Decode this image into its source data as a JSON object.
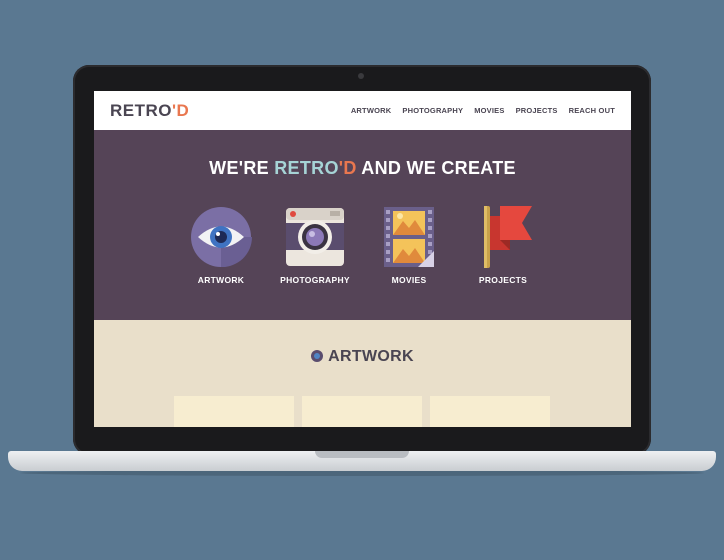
{
  "site": {
    "logo_main": "RETRO",
    "logo_accent": "'D",
    "nav": [
      {
        "label": "ARTWORK"
      },
      {
        "label": "PHOTOGRAPHY"
      },
      {
        "label": "MOVIES"
      },
      {
        "label": "PROJECTS"
      },
      {
        "label": "REACH OUT"
      }
    ]
  },
  "hero": {
    "title_pre": "WE'RE ",
    "title_hl1": "RETRO",
    "title_hl2": "'D",
    "title_post": " AND WE CREATE",
    "features": [
      {
        "label": "ARTWORK",
        "icon": "eye-icon"
      },
      {
        "label": "PHOTOGRAPHY",
        "icon": "camera-icon"
      },
      {
        "label": "MOVIES",
        "icon": "film-icon"
      },
      {
        "label": "PROJECTS",
        "icon": "flag-icon"
      }
    ]
  },
  "artwork_section": {
    "title": "ARTWORK"
  },
  "colors": {
    "background": "#5a7891",
    "hero": "#554457",
    "accent_orange": "#e9774f",
    "accent_teal": "#a6d4d6",
    "section_bg": "#e9dfca"
  }
}
